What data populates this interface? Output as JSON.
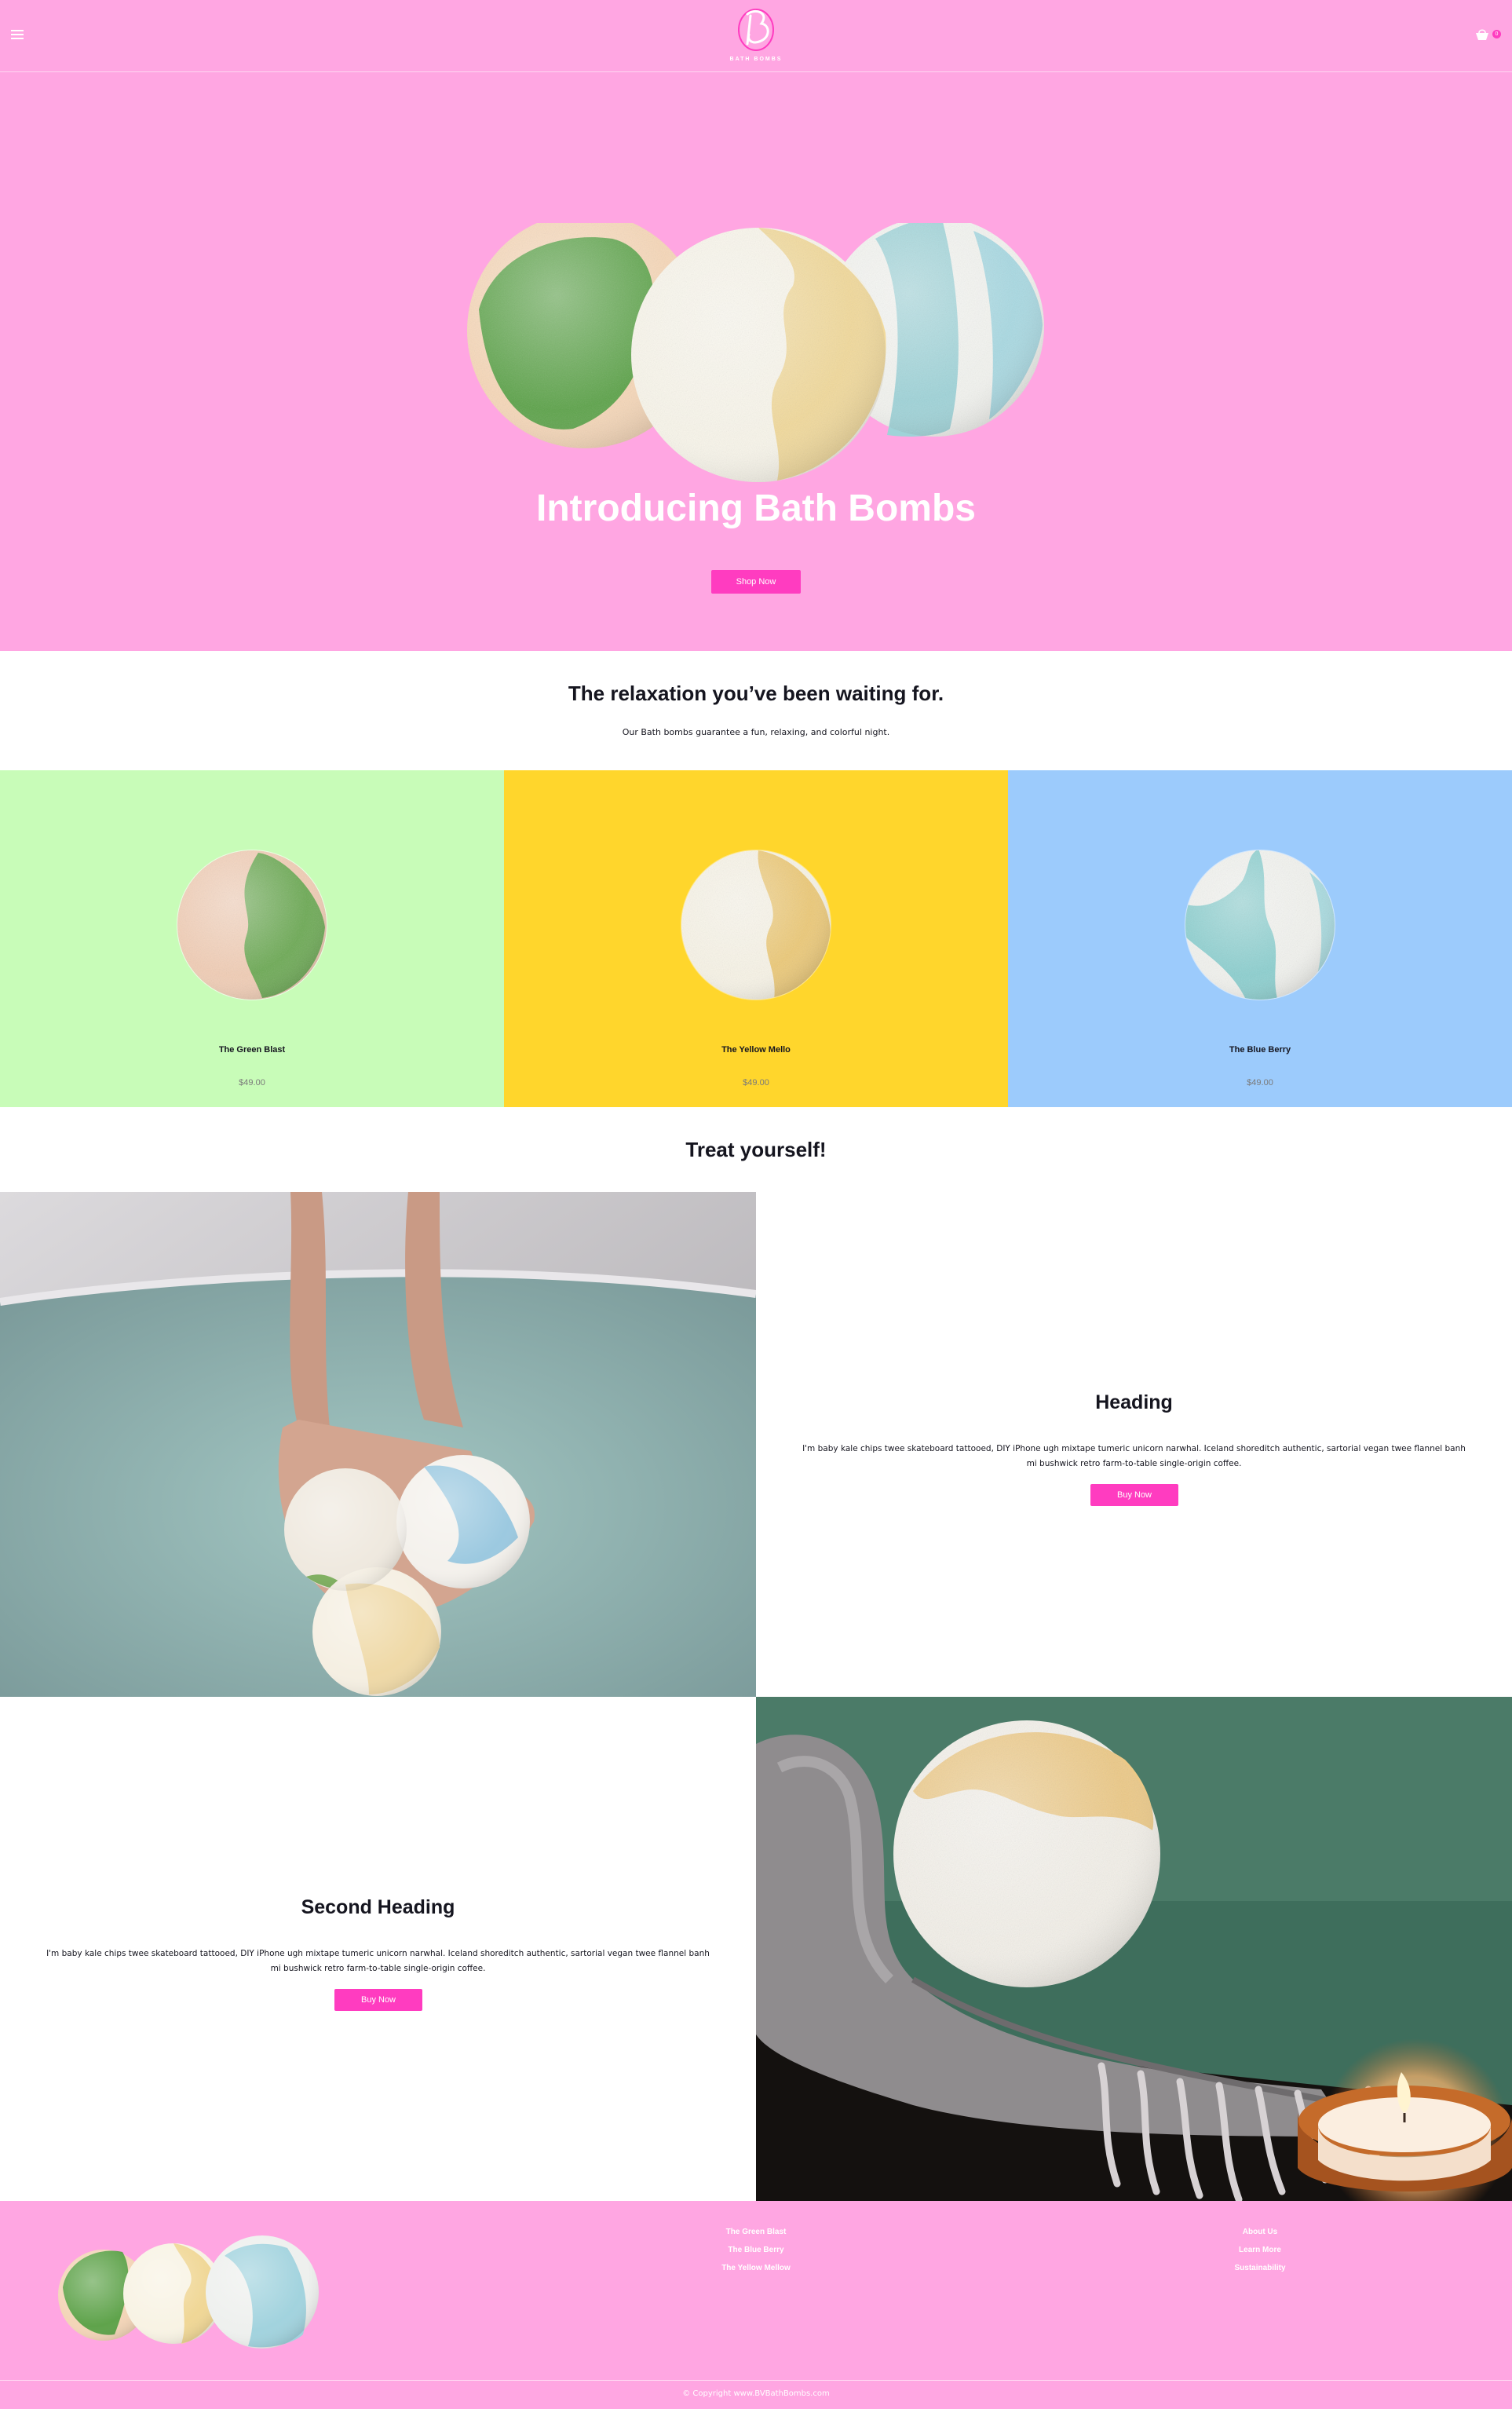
{
  "header": {
    "logo_text": "BATH BOMBS",
    "cart_count": "0"
  },
  "hero": {
    "title": "Introducing Bath Bombs",
    "button_label": "Shop Now"
  },
  "intro": {
    "title": "The relaxation you’ve been waiting for.",
    "subtitle": "Our Bath bombs guarantee a fun, relaxing, and colorful night."
  },
  "products": [
    {
      "name": "The Green Blast",
      "price": "$49.00",
      "color": "#c8fcb8"
    },
    {
      "name": "The Yellow Mello",
      "price": "$49.00",
      "color": "#ffd62c"
    },
    {
      "name": "The Blue Berry",
      "price": "$49.00",
      "color": "#9ccbfc"
    }
  ],
  "treat": {
    "title": "Treat yourself!"
  },
  "features": [
    {
      "heading": "Heading",
      "text": "I'm baby kale chips twee skateboard tattooed, DIY iPhone ugh mixtape tumeric unicorn narwhal. Iceland shoreditch authentic, sartorial vegan twee flannel banh mi bushwick retro farm-to-table single-origin coffee.",
      "button_label": "Buy Now"
    },
    {
      "heading": "Second Heading",
      "text": "I'm baby kale chips twee skateboard tattooed, DIY iPhone ugh mixtape tumeric unicorn narwhal. Iceland shoreditch authentic, sartorial vegan twee flannel banh mi bushwick retro farm-to-table single-origin coffee.",
      "button_label": "Buy Now"
    }
  ],
  "footer": {
    "products_links": [
      "The Green Blast",
      "The Blue Berry",
      "The Yellow Mellow"
    ],
    "info_links": [
      "About Us",
      "Learn More",
      "Sustainability"
    ],
    "copyright": "© Copyright www.BVBathBombs.com"
  },
  "colors": {
    "brand_pink": "#ffa6e2",
    "button_pink": "#ff3cc0",
    "text_dark": "#15151f"
  },
  "icons": [
    "menu-icon",
    "cart-icon",
    "logo-mark"
  ]
}
